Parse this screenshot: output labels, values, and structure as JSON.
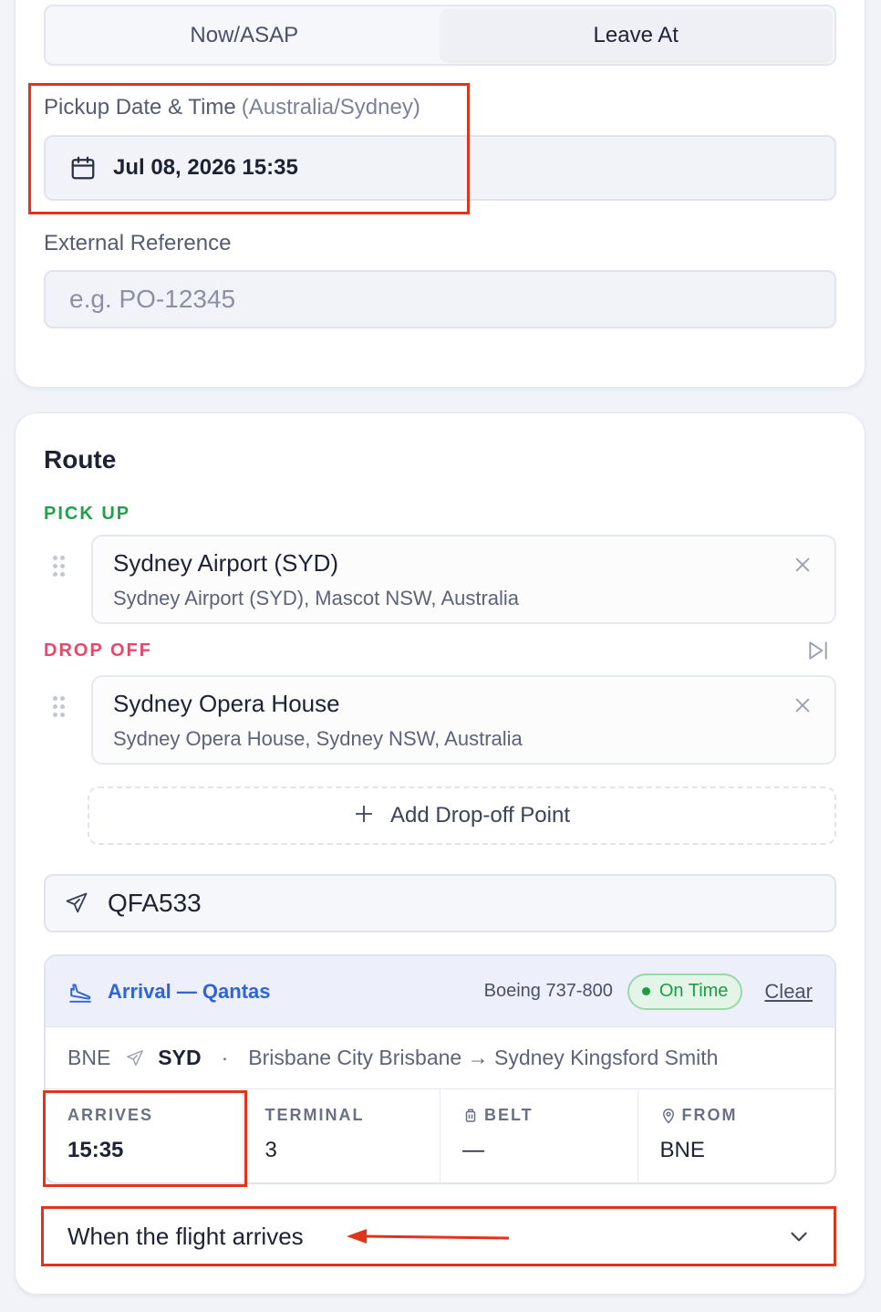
{
  "departure_mode": {
    "options": [
      "Now/ASAP",
      "Leave At"
    ],
    "selected": "Leave At"
  },
  "pickup": {
    "label": "Pickup Date & Time",
    "timezone": "(Australia/Sydney)",
    "value": "Jul 08, 2026 15:35"
  },
  "external_reference": {
    "label": "External Reference",
    "placeholder": "e.g. PO-12345"
  },
  "route": {
    "title": "Route",
    "pickup_label": "PICK UP",
    "dropoff_label": "DROP OFF",
    "pickup_stop": {
      "name": "Sydney Airport (SYD)",
      "address": "Sydney Airport (SYD), Mascot NSW, Australia"
    },
    "dropoff_stop": {
      "name": "Sydney Opera House",
      "address": "Sydney Opera House, Sydney NSW, Australia"
    },
    "add_dropoff": "Add Drop-off Point"
  },
  "flight": {
    "number": "QFA533",
    "title": "Arrival — Qantas",
    "aircraft": "Boeing 737-800",
    "status": "On Time",
    "clear": "Clear",
    "origin": "BNE",
    "destination": "SYD",
    "dot": "·",
    "route_text": "Brisbane City Brisbane → Sydney Kingsford Smith",
    "stats": {
      "arrives_label": "ARRIVES",
      "arrives_value": "15:35",
      "terminal_label": "TERMINAL",
      "terminal_value": "3",
      "belt_label": "BELT",
      "belt_value": "—",
      "from_label": "FROM",
      "from_value": "BNE"
    }
  },
  "pickup_timing": {
    "selected": "When the flight arrives"
  },
  "colors": {
    "annotation": "#e2341d",
    "pickup": "#21a24a",
    "dropoff": "#e8476a",
    "accent": "#2e63d9",
    "on_time": "#1e9b44"
  }
}
